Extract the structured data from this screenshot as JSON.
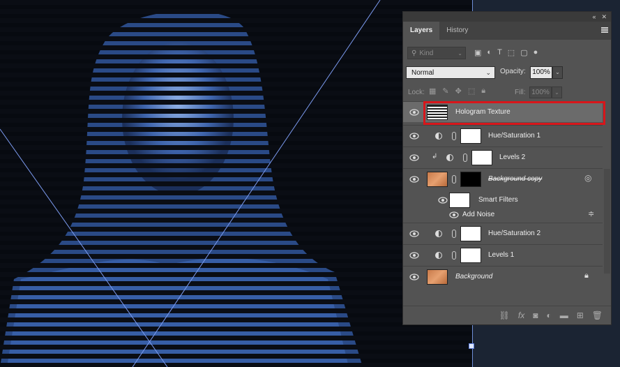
{
  "panel": {
    "collapse_glyph": "«",
    "close_glyph": "✕",
    "tabs": [
      {
        "label": "Layers",
        "active": true
      },
      {
        "label": "History",
        "active": false
      }
    ],
    "filter": {
      "placeholder": "Kind"
    },
    "blend_mode": "Normal",
    "opacity_label": "Opacity:",
    "opacity_value": "100%",
    "lock_label": "Lock:",
    "fill_label": "Fill:",
    "fill_value": "100%"
  },
  "layers": [
    {
      "name": "Hologram Texture",
      "selected": true,
      "thumb": "texture"
    },
    {
      "name": "Hue/Saturation 1",
      "type": "adjustment"
    },
    {
      "name": "Levels 2",
      "type": "adjustment",
      "clipped": true
    },
    {
      "name": "Background copy",
      "type": "smart-object",
      "strike": true
    },
    {
      "name": "Smart Filters",
      "type": "filter-group"
    },
    {
      "name": "Add Noise",
      "type": "filter"
    },
    {
      "name": "Hue/Saturation 2",
      "type": "adjustment"
    },
    {
      "name": "Levels 1",
      "type": "adjustment"
    },
    {
      "name": "Background",
      "type": "background",
      "italic": true
    }
  ],
  "colors": {
    "highlight": "#d8161b",
    "panel_bg": "#535353",
    "canvas_blue": "#4d78c4",
    "guide": "#6f8fd8"
  },
  "icons": [
    "eye-icon",
    "chain-icon",
    "adjustment-icon",
    "lock-icon",
    "link-icon",
    "fx-icon",
    "mask-icon",
    "folder-icon",
    "new-layer-icon",
    "trash-icon"
  ]
}
